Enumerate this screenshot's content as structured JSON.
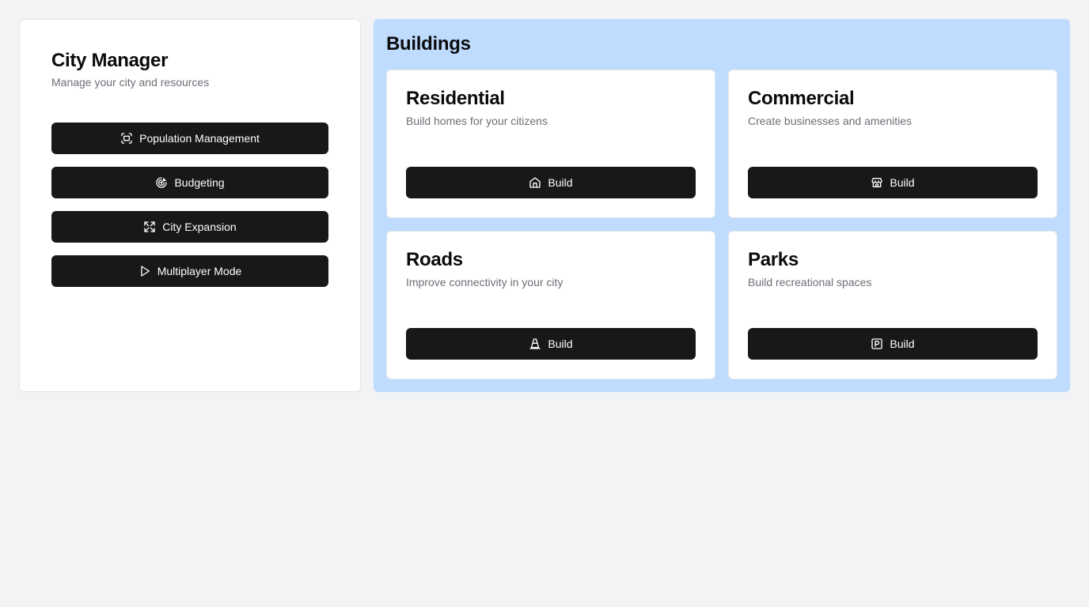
{
  "sidebar": {
    "title": "City Manager",
    "subtitle": "Manage your city and resources",
    "buttons": [
      {
        "label": "Population Management",
        "icon": "scan-face-icon"
      },
      {
        "label": "Budgeting",
        "icon": "target-icon"
      },
      {
        "label": "City Expansion",
        "icon": "expand-icon"
      },
      {
        "label": "Multiplayer Mode",
        "icon": "play-icon"
      }
    ]
  },
  "buildings": {
    "title": "Buildings",
    "cards": [
      {
        "title": "Residential",
        "description": "Build homes for your citizens",
        "button": "Build",
        "icon": "house-icon"
      },
      {
        "title": "Commercial",
        "description": "Create businesses and amenities",
        "button": "Build",
        "icon": "store-icon"
      },
      {
        "title": "Roads",
        "description": "Improve connectivity in your city",
        "button": "Build",
        "icon": "traffic-cone-icon"
      },
      {
        "title": "Parks",
        "description": "Build recreational spaces",
        "button": "Build",
        "icon": "parking-icon"
      }
    ]
  },
  "colors": {
    "background": "#f2f3f5",
    "panel": "#bfdbfe",
    "button": "#18181b"
  }
}
